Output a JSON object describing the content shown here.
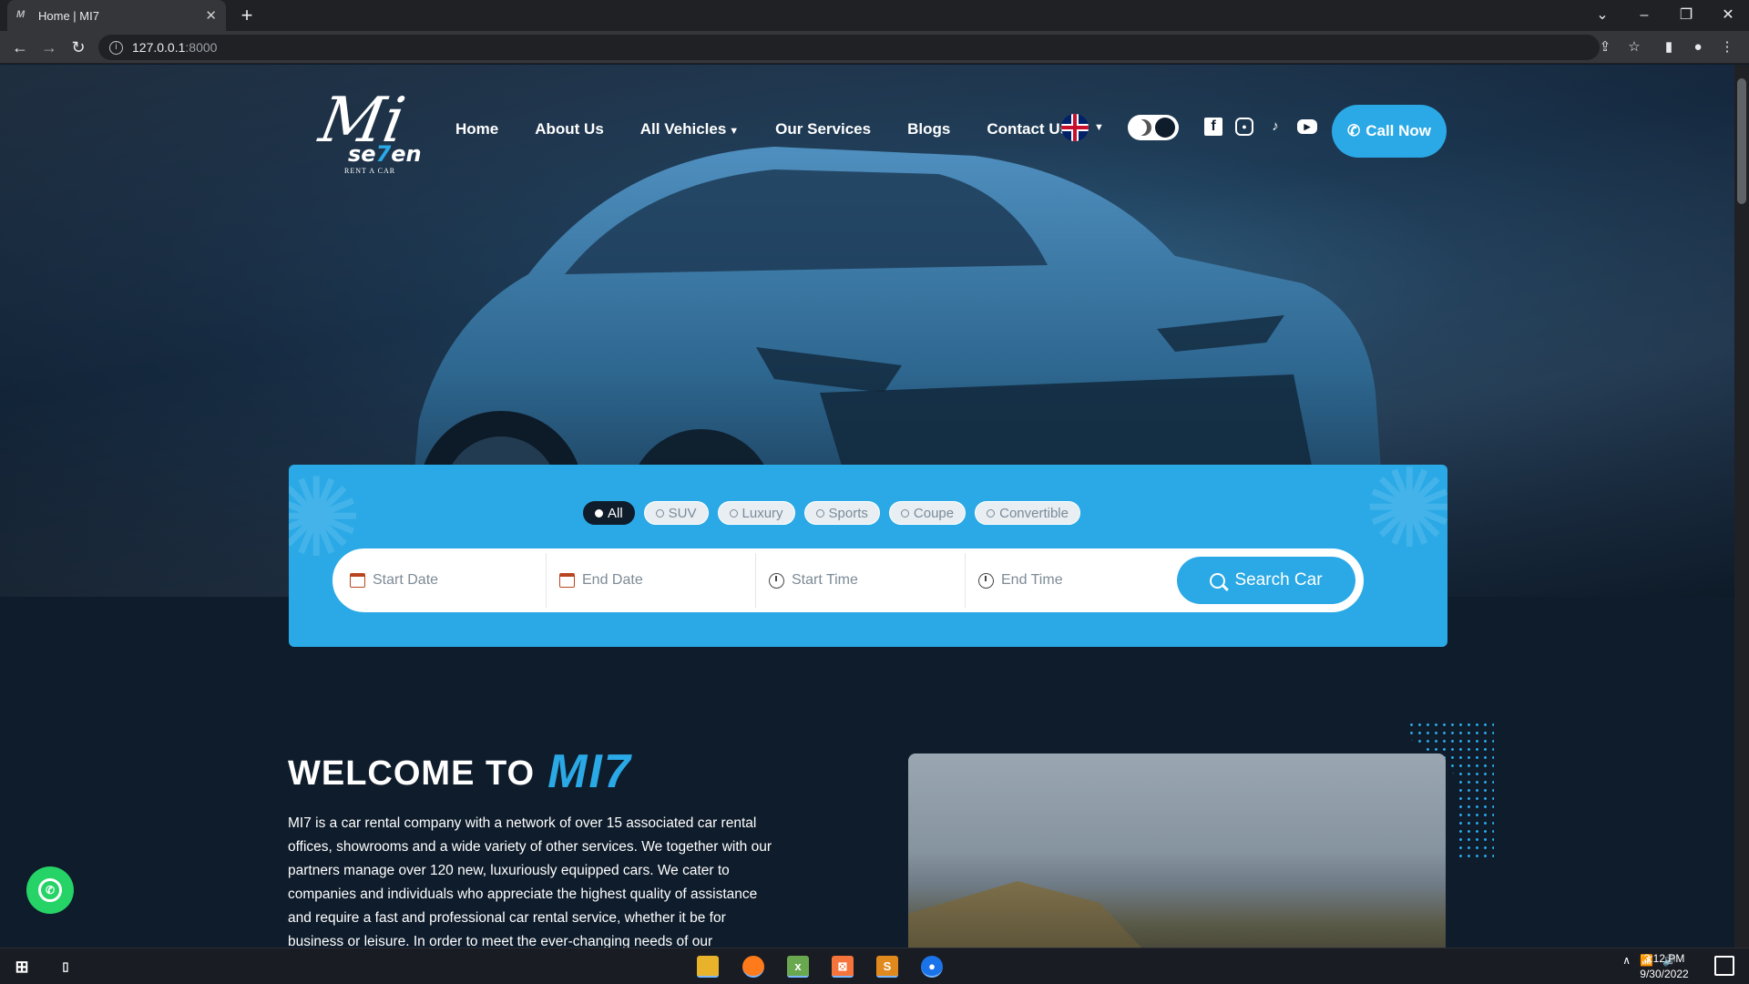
{
  "browser": {
    "tab_title": "Home | MI7",
    "url_host": "127.0.0.1",
    "url_port": ":8000"
  },
  "header": {
    "logo_mark": "Mi",
    "logo_word_a": "se",
    "logo_word_b": "7",
    "logo_word_c": "en",
    "logo_tagline": "RENT A CAR",
    "nav": [
      {
        "label": "Home"
      },
      {
        "label": "About Us"
      },
      {
        "label": "All Vehicles"
      },
      {
        "label": "Our Services"
      },
      {
        "label": "Blogs"
      },
      {
        "label": "Contact Us"
      }
    ],
    "language_flag": "uk-flag-icon",
    "social_icons": [
      "facebook-icon",
      "instagram-icon",
      "tiktok-icon",
      "youtube-icon"
    ],
    "call_label": "Call Now"
  },
  "search": {
    "filters": [
      {
        "label": "All",
        "active": true
      },
      {
        "label": "SUV",
        "active": false
      },
      {
        "label": "Luxury",
        "active": false
      },
      {
        "label": "Sports",
        "active": false
      },
      {
        "label": "Coupe",
        "active": false
      },
      {
        "label": "Convertible",
        "active": false
      }
    ],
    "start_date_placeholder": "Start Date",
    "end_date_placeholder": "End Date",
    "start_time_placeholder": "Start Time",
    "end_time_placeholder": "End Time",
    "button_label": "Search Car"
  },
  "welcome": {
    "title_prefix": "WELCOME TO",
    "title_brand": "MI7",
    "body": "MI7 is a car rental company with a network of over 15 associated car rental offices, showrooms and a wide variety of other services. We together with our partners manage over 120 new, luxuriously equipped cars. We cater to companies and individuals who appreciate the highest quality of assistance and require a fast and professional car rental service, whether it be for business or leisure. In order to meet the ever-changing needs of our"
  },
  "taskbar": {
    "time": "3:12 PM",
    "date": "9/30/2022"
  },
  "colors": {
    "accent": "#2aa9e6",
    "background": "#0f1c2b",
    "whatsapp": "#25d366"
  }
}
